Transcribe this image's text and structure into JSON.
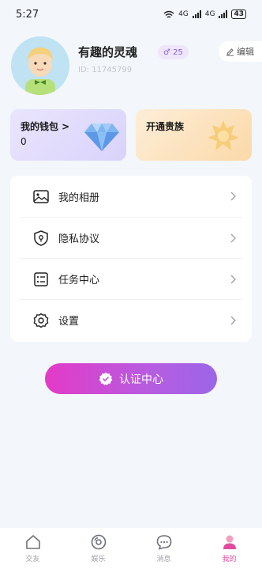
{
  "status_bar": {
    "time": "5:27",
    "network1": "4G",
    "network2": "4G",
    "battery": "43"
  },
  "profile": {
    "nickname": "有趣的灵魂",
    "gender_symbol": "♂",
    "age": "25",
    "user_id": "ID: 11745799",
    "edit_label": "编辑"
  },
  "cards": {
    "wallet": {
      "title": "我的钱包 >",
      "value": "0"
    },
    "vip": {
      "title": "开通贵族"
    }
  },
  "menu": {
    "items": [
      {
        "label": "我的相册",
        "icon": "image-icon"
      },
      {
        "label": "隐私协议",
        "icon": "shield-icon"
      },
      {
        "label": "任务中心",
        "icon": "task-list-icon"
      },
      {
        "label": "设置",
        "icon": "gear-icon"
      }
    ]
  },
  "verify_button": {
    "label": "认证中心"
  },
  "tabs": [
    {
      "label": "交友",
      "icon": "home-icon"
    },
    {
      "label": "娱乐",
      "icon": "disc-icon"
    },
    {
      "label": "消息",
      "icon": "chat-icon"
    },
    {
      "label": "我的",
      "icon": "person-icon",
      "active": true
    }
  ],
  "colors": {
    "accent": "#e34ba0",
    "gradient_start": "#e33ac7",
    "gradient_end": "#9b66e8",
    "gender_badge": "#8a60e0"
  }
}
